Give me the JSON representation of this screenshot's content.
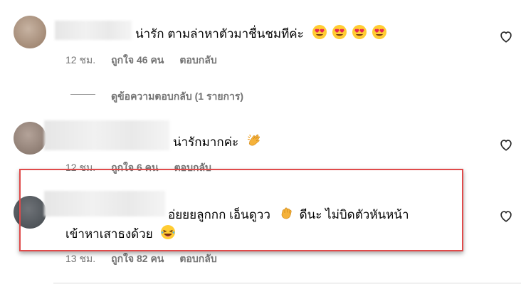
{
  "comments": [
    {
      "text": "น่ารัก ตามล่าหาตัวมาชื่นชมทีค่ะ",
      "emojis": [
        "heart-eyes-emoji",
        "heart-eyes-emoji",
        "heart-eyes-emoji",
        "heart-eyes-emoji"
      ],
      "time": "12 ชม.",
      "likes": "ถูกใจ 46 คน",
      "reply": "ตอบกลับ",
      "avatar_color": "#b19a86"
    },
    {
      "text": "น่ารักมากค่ะ",
      "emojis": [
        "clapping-hands-emoji"
      ],
      "time": "12 ชม.",
      "likes": "ถูกใจ 6 คน",
      "reply": "ตอบกลับ",
      "avatar_color": "#9c8a80"
    },
    {
      "text_line1": "อ่ยยยลูกกก เอ็นดูวว",
      "text_line1b": "ดีนะ ไม่บิดตัวหันหน้า",
      "text_line2": "เข้าหาเสาธงด้วย",
      "emojis": [
        "fist-emoji",
        "laughing-emoji"
      ],
      "time": "13 ชม.",
      "likes": "ถูกใจ 82 คน",
      "reply": "ตอบกลับ",
      "avatar_color": "#5b5f63"
    }
  ],
  "view_replies": "ดูข้อความตอบกลับ (1 รายการ)",
  "colors": {
    "highlight": "#e04a4a",
    "meta": "#737373"
  }
}
